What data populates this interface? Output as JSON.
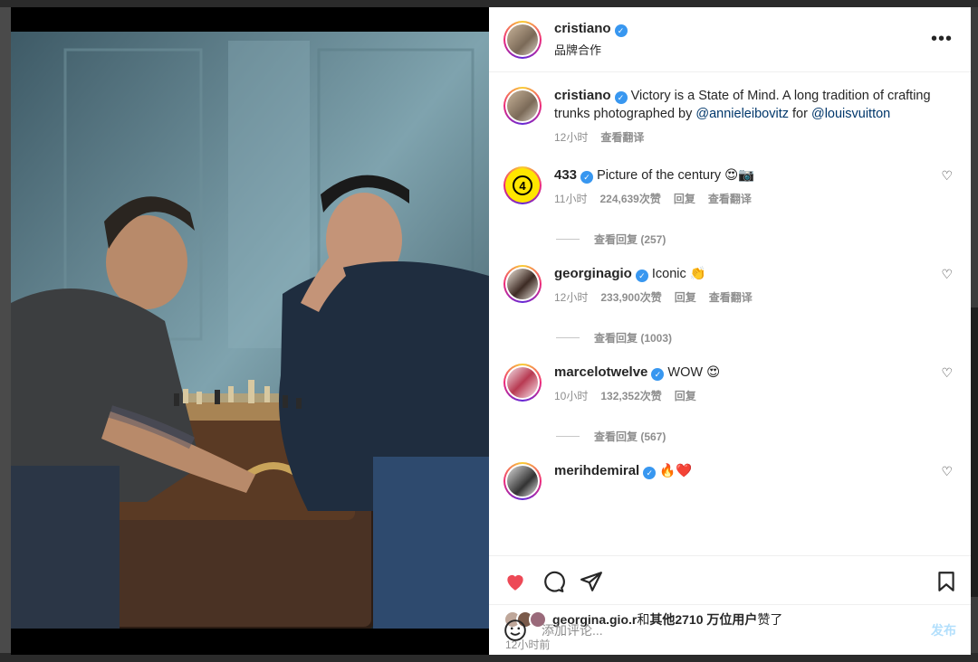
{
  "header": {
    "username": "cristiano",
    "subtitle": "品牌合作",
    "more_label": "•••"
  },
  "caption": {
    "username": "cristiano",
    "text_before": "Victory is a State of Mind. A long tradition of crafting trunks photographed by ",
    "mention1": "@annieleibovitz",
    "text_mid": " for ",
    "mention2": "@louisvuitton",
    "time": "12小时",
    "translate": "查看翻译"
  },
  "comments": [
    {
      "username": "433",
      "text": "Picture of the century 😍📷",
      "time": "11小时",
      "likes": "224,639次赞",
      "reply": "回复",
      "translate": "查看翻译",
      "view_replies": "查看回复 (257)",
      "avatar_label": "4"
    },
    {
      "username": "georginagio",
      "text": "Iconic 👏",
      "time": "12小时",
      "likes": "233,900次赞",
      "reply": "回复",
      "translate": "查看翻译",
      "view_replies": "查看回复 (1003)"
    },
    {
      "username": "marcelotwelve",
      "text": "WOW 😍",
      "time": "10小时",
      "likes": "132,352次赞",
      "reply": "回复",
      "view_replies": "查看回复 (567)"
    },
    {
      "username": "merihdemiral",
      "text": "🔥❤️"
    }
  ],
  "likes_line": {
    "user": "georgina.gio.r",
    "and": "和",
    "others": "其他2710 万位用户",
    "suffix": "赞了"
  },
  "post_time": "12小时前",
  "add_comment": {
    "placeholder": "添加评论...",
    "post_label": "发布"
  },
  "colors": {
    "like_red": "#ed4956",
    "verified_blue": "#3897f0",
    "link": "#00376b",
    "post_button": "#b2dffc"
  }
}
